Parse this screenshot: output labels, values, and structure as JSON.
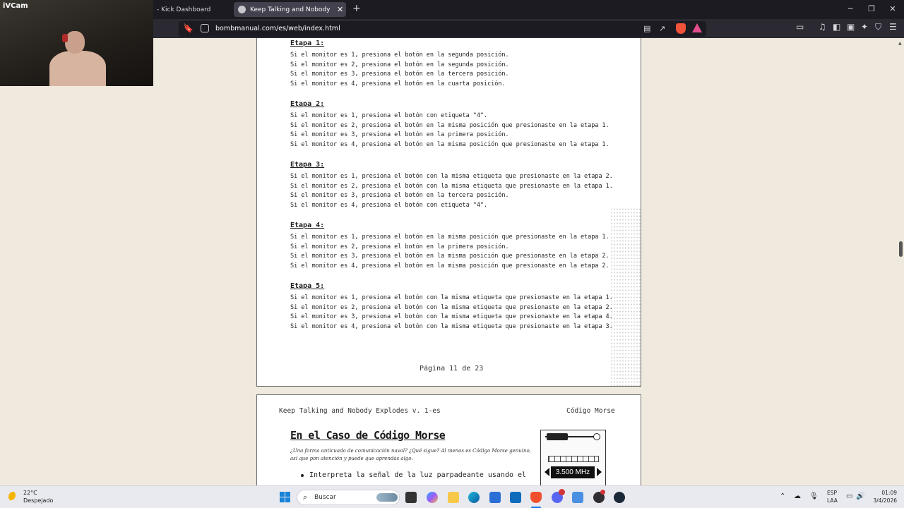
{
  "browser": {
    "tabs": [
      {
        "title": "- Kick Dashboard"
      },
      {
        "title": "Keep Talking and Nobody Explodes"
      }
    ],
    "url": "bombmanual.com/es/web/index.html"
  },
  "webcam": {
    "label": "iVCam"
  },
  "page1": {
    "stages": [
      {
        "heading": "Etapa 1:",
        "lines": [
          "Si el monitor es 1, presiona el botón en la segunda posición.",
          "Si el monitor es 2, presiona el botón en la segunda posición.",
          "Si el monitor es 3, presiona el botón en la tercera posición.",
          "Si el monitor es 4, presiona el botón en la cuarta posición."
        ]
      },
      {
        "heading": "Etapa 2:",
        "lines": [
          "Si el monitor es 1, presiona el botón con etiqueta \"4\".",
          "Si el monitor es 2, presiona el botón en la misma posición que presionaste en la etapa 1.",
          "Si el monitor es 3, presiona el botón en la primera posición.",
          "Si el monitor es 4, presiona el botón en la misma posición que presionaste en la etapa 1."
        ]
      },
      {
        "heading": "Etapa 3:",
        "lines": [
          "Si el monitor es 1, presiona el botón con la misma etiqueta que presionaste en la etapa 2.",
          "Si el monitor es 2, presiona el botón con la misma etiqueta que presionaste en la etapa 1.",
          "Si el monitor es 3, presiona el botón en la tercera posición.",
          "Si el monitor es 4, presiona el botón con etiqueta \"4\"."
        ]
      },
      {
        "heading": "Etapa 4:",
        "lines": [
          "Si el monitor es 1, presiona el botón en la misma posición que presionaste en la etapa 1.",
          "Si el monitor es 2, presiona el botón en la primera posición.",
          "Si el monitor es 3, presiona el botón en la misma posición que presionaste en la etapa 2.",
          "Si el monitor es 4, presiona el botón en la misma posición que presionaste en la etapa 2."
        ]
      },
      {
        "heading": "Etapa 5:",
        "lines": [
          "Si el monitor es 1, presiona el botón con la misma etiqueta que presionaste en la etapa 1.",
          "Si el monitor es 2, presiona el botón con la misma etiqueta que presionaste en la etapa 2.",
          "Si el monitor es 3, presiona el botón con la misma etiqueta que presionaste en la etapa 4.",
          "Si el monitor es 4, presiona el botón con la misma etiqueta que presionaste en la etapa 3."
        ]
      }
    ],
    "page_number": "Página 11 de 23"
  },
  "page2": {
    "header_left": "Keep Talking and Nobody Explodes v. 1-es",
    "header_right": "Código Morse",
    "title": "En el Caso de Código Morse",
    "subtitle": "¿Una forma anticuada de comunicación naval? ¿Qué sigue? Al menos es Código Morse genuino, así que pon atención y puede que aprendas algo.",
    "bullet": "Interpreta la señal de la luz parpadeante usando el",
    "module_frequency": "3.500 MHz"
  },
  "taskbar": {
    "weather_temp": "22°C",
    "weather_desc": "Despejado",
    "search_label": "Buscar",
    "lang_top": "ESP",
    "lang_bottom": "LAA",
    "time": "01:09",
    "date": "3/4/2026"
  }
}
